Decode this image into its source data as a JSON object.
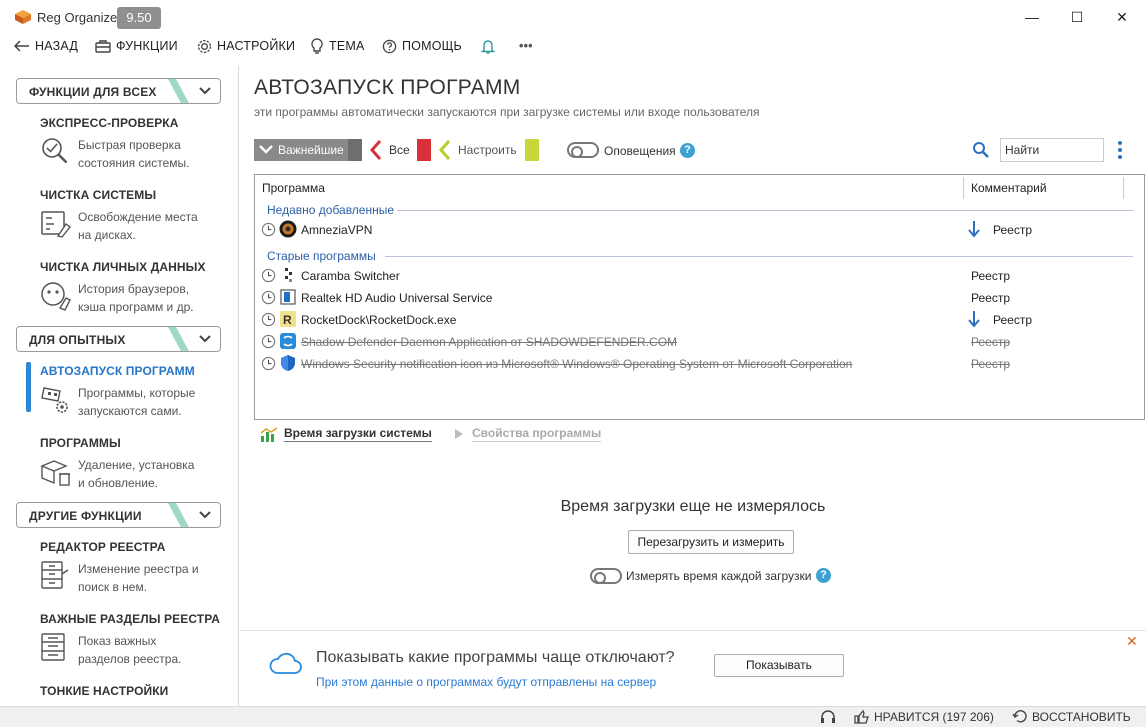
{
  "window": {
    "app_name": "Reg Organizer",
    "version": "9.50",
    "minimize_glyph": "—",
    "maximize_glyph": "☐",
    "close_glyph": "✕"
  },
  "menu": {
    "back": "НАЗАД",
    "functions": "ФУНКЦИИ",
    "settings": "НАСТРОЙКИ",
    "theme": "ТЕМА",
    "help": "ПОМОЩЬ",
    "more": "•••"
  },
  "sidebar": {
    "sections": [
      {
        "label": "ФУНКЦИИ ДЛЯ ВСЕХ"
      },
      {
        "label": "ДЛЯ ОПЫТНЫХ"
      },
      {
        "label": "ДРУГИЕ ФУНКЦИИ"
      }
    ],
    "items": [
      {
        "title": "ЭКСПРЕСС-ПРОВЕРКА",
        "line1": "Быстрая проверка",
        "line2": "состояния системы."
      },
      {
        "title": "ЧИСТКА СИСТЕМЫ",
        "line1": "Освобождение места",
        "line2": "на дисках."
      },
      {
        "title": "ЧИСТКА ЛИЧНЫХ ДАННЫХ",
        "line1": "История браузеров,",
        "line2": "кэша программ и др."
      },
      {
        "title": "АВТОЗАПУСК ПРОГРАММ",
        "line1": "Программы, которые",
        "line2": "запускаются сами."
      },
      {
        "title": "ПРОГРАММЫ",
        "line1": "Удаление, установка",
        "line2": "и обновление."
      },
      {
        "title": "РЕДАКТОР РЕЕСТРА",
        "line1": "Изменение реестра и",
        "line2": "поиск в нем."
      },
      {
        "title": "ВАЖНЫЕ РАЗДЕЛЫ РЕЕСТРА",
        "line1": "Показ важных",
        "line2": "разделов реестра."
      },
      {
        "title": "ТОНКИЕ НАСТРОЙКИ",
        "line1": "",
        "line2": ""
      }
    ]
  },
  "main": {
    "title": "АВТОЗАПУСК ПРОГРАММ",
    "subtitle": "эти программы автоматически запускаются при загрузке системы или входе пользователя",
    "filters": {
      "important": "Важнейшие",
      "all": "Все",
      "configure": "Настроить"
    },
    "notifications_label": "Оповещения",
    "search_placeholder": "Найти",
    "table": {
      "col_program": "Программа",
      "col_comment": "Комментарий",
      "group_recent": "Недавно добавленные",
      "group_old": "Старые программы",
      "rows": [
        {
          "name": "AmneziaVPN",
          "comment": "Реестр"
        },
        {
          "name": "Caramba Switcher",
          "comment": "Реестр"
        },
        {
          "name": "Realtek HD Audio Universal Service",
          "comment": "Реестр"
        },
        {
          "name": "RocketDock\\RocketDock.exe",
          "comment": "Реестр"
        },
        {
          "name": "Shadow Defender Daemon Application от SHADOWDEFENDER.COM",
          "comment": "Реестр"
        },
        {
          "name": "Windows Security notification icon из Microsoft® Windows® Operating System от Microsoft Corporation",
          "comment": "Реестр"
        }
      ]
    },
    "tabs": {
      "boot_time": "Время загрузки системы",
      "properties": "Свойства программы"
    },
    "boot_message": "Время загрузки еще не измерялось",
    "reboot_button": "Перезагрузить и измерить",
    "measure_label": "Измерять время каждой загрузки"
  },
  "notice": {
    "question": "Показывать какие программы чаще отключают?",
    "sub": "При этом данные о программах будут отправлены на сервер",
    "button": "Показывать",
    "close_glyph": "✕"
  },
  "status": {
    "like": "НРАВИТСЯ (197 206)",
    "restore": "ВОССТАНОВИТЬ"
  },
  "colors": {
    "accent": "#2e86d8",
    "stripe": "#9fd8c8",
    "all_red": "#d9303a",
    "configure_yellow": "#b8cc2c",
    "link": "#2a7bd3"
  }
}
